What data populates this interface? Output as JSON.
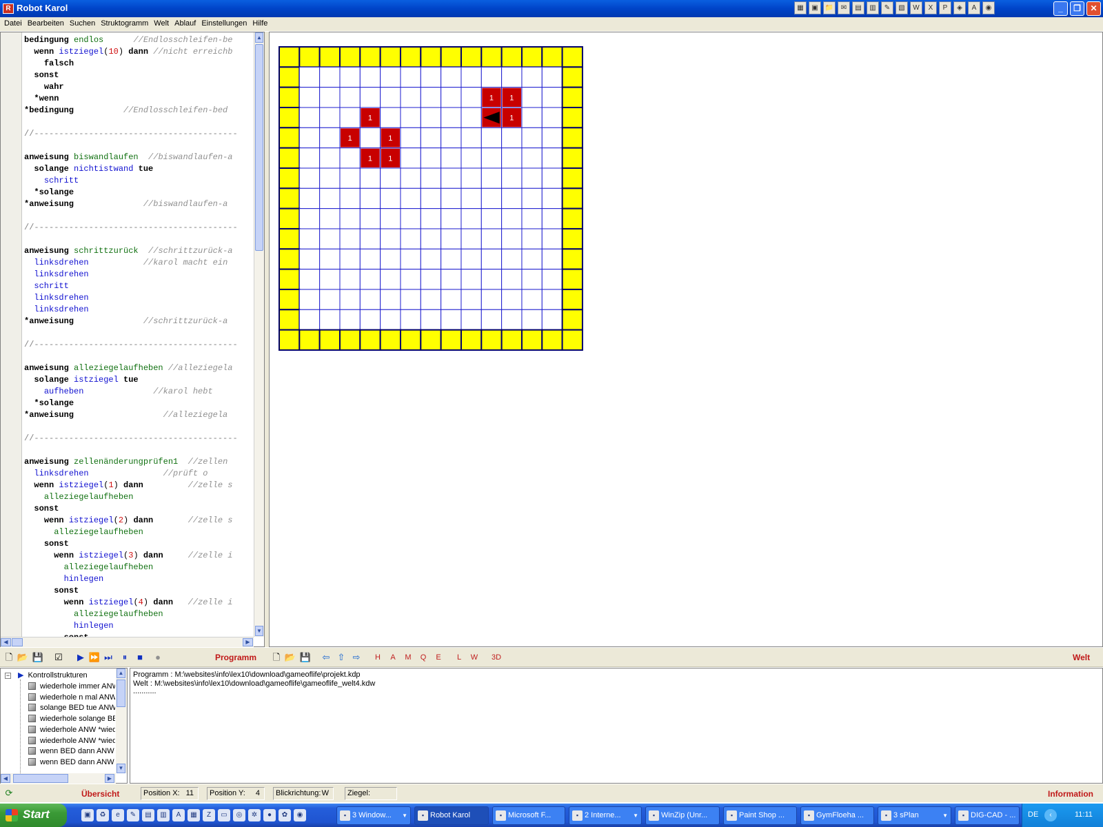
{
  "window": {
    "title": "Robot Karol",
    "icon": "robot-karol-icon",
    "tray_icons": [
      "app-icon",
      "window-icon",
      "folder-icon",
      "mail-icon",
      "doc-icon",
      "clipboard-icon",
      "note-icon",
      "book-icon",
      "word-icon",
      "excel-icon",
      "powerpoint-icon",
      "graphics-icon",
      "access-icon",
      "network-icon"
    ],
    "buttons": [
      "_",
      "❐",
      "✕"
    ]
  },
  "menu": [
    "Datei",
    "Bearbeiten",
    "Suchen",
    "Struktogramm",
    "Welt",
    "Ablauf",
    "Einstellungen",
    "Hilfe"
  ],
  "code_lines": [
    [
      [
        "kw",
        "bedingung "
      ],
      [
        "nm",
        "endlos"
      ],
      [
        "",
        "      "
      ],
      [
        "cm",
        "//Endlosschleifen-be"
      ]
    ],
    [
      [
        "",
        "  "
      ],
      [
        "kw",
        "wenn "
      ],
      [
        "id",
        "istziegel"
      ],
      [
        "",
        "("
      ],
      [
        "num",
        "10"
      ],
      [
        "",
        ") "
      ],
      [
        "kw",
        "dann"
      ],
      [
        "",
        " "
      ],
      [
        "cm",
        "//nicht erreichb"
      ]
    ],
    [
      [
        "",
        "    "
      ],
      [
        "kw",
        "falsch"
      ]
    ],
    [
      [
        "",
        "  "
      ],
      [
        "kw",
        "sonst"
      ]
    ],
    [
      [
        "",
        "    "
      ],
      [
        "kw",
        "wahr"
      ]
    ],
    [
      [
        "",
        "  "
      ],
      [
        "kw",
        "*wenn"
      ]
    ],
    [
      [
        "kw",
        "*bedingung"
      ],
      [
        "",
        "          "
      ],
      [
        "cm",
        "//Endlosschleifen-bed"
      ]
    ],
    [],
    [
      [
        "dash",
        "//-----------------------------------------"
      ]
    ],
    [],
    [
      [
        "kw",
        "anweisung "
      ],
      [
        "nm",
        "biswandlaufen"
      ],
      [
        "",
        "  "
      ],
      [
        "cm",
        "//biswandlaufen-a"
      ]
    ],
    [
      [
        "",
        "  "
      ],
      [
        "kw",
        "solange "
      ],
      [
        "id",
        "nichtistwand"
      ],
      [
        "",
        " "
      ],
      [
        "kw",
        "tue"
      ]
    ],
    [
      [
        "",
        "    "
      ],
      [
        "id",
        "schritt"
      ]
    ],
    [
      [
        "",
        "  "
      ],
      [
        "kw",
        "*solange"
      ]
    ],
    [
      [
        "kw",
        "*anweisung"
      ],
      [
        "",
        "              "
      ],
      [
        "cm",
        "//biswandlaufen-a"
      ]
    ],
    [],
    [
      [
        "dash",
        "//-----------------------------------------"
      ]
    ],
    [],
    [
      [
        "kw",
        "anweisung "
      ],
      [
        "nm",
        "schrittzurück"
      ],
      [
        "",
        "  "
      ],
      [
        "cm",
        "//schrittzurück-a"
      ]
    ],
    [
      [
        "",
        "  "
      ],
      [
        "id",
        "linksdrehen"
      ],
      [
        "",
        "           "
      ],
      [
        "cm",
        "//karol macht ein"
      ]
    ],
    [
      [
        "",
        "  "
      ],
      [
        "id",
        "linksdrehen"
      ]
    ],
    [
      [
        "",
        "  "
      ],
      [
        "id",
        "schritt"
      ]
    ],
    [
      [
        "",
        "  "
      ],
      [
        "id",
        "linksdrehen"
      ]
    ],
    [
      [
        "",
        "  "
      ],
      [
        "id",
        "linksdrehen"
      ]
    ],
    [
      [
        "kw",
        "*anweisung"
      ],
      [
        "",
        "              "
      ],
      [
        "cm",
        "//schrittzurück-a"
      ]
    ],
    [],
    [
      [
        "dash",
        "//-----------------------------------------"
      ]
    ],
    [],
    [
      [
        "kw",
        "anweisung "
      ],
      [
        "nm",
        "alleziegelaufheben"
      ],
      [
        "",
        " "
      ],
      [
        "cm",
        "//alleziegela"
      ]
    ],
    [
      [
        "",
        "  "
      ],
      [
        "kw",
        "solange "
      ],
      [
        "id",
        "istziegel"
      ],
      [
        "",
        " "
      ],
      [
        "kw",
        "tue"
      ]
    ],
    [
      [
        "",
        "    "
      ],
      [
        "id",
        "aufheben"
      ],
      [
        "",
        "              "
      ],
      [
        "cm",
        "//karol hebt"
      ]
    ],
    [
      [
        "",
        "  "
      ],
      [
        "kw",
        "*solange"
      ]
    ],
    [
      [
        "kw",
        "*anweisung"
      ],
      [
        "",
        "                  "
      ],
      [
        "cm",
        "//alleziegela"
      ]
    ],
    [],
    [
      [
        "dash",
        "//-----------------------------------------"
      ]
    ],
    [],
    [
      [
        "kw",
        "anweisung "
      ],
      [
        "nm",
        "zellenänderungprüfen1"
      ],
      [
        "",
        "  "
      ],
      [
        "cm",
        "//zellen"
      ]
    ],
    [
      [
        "",
        "  "
      ],
      [
        "id",
        "linksdrehen"
      ],
      [
        "",
        "               "
      ],
      [
        "cm",
        "//prüft o"
      ]
    ],
    [
      [
        "",
        "  "
      ],
      [
        "kw",
        "wenn "
      ],
      [
        "id",
        "istziegel"
      ],
      [
        "",
        "("
      ],
      [
        "num",
        "1"
      ],
      [
        "",
        ") "
      ],
      [
        "kw",
        "dann"
      ],
      [
        "",
        "         "
      ],
      [
        "cm",
        "//zelle s"
      ]
    ],
    [
      [
        "",
        "    "
      ],
      [
        "nm",
        "alleziegelaufheben"
      ]
    ],
    [
      [
        "",
        "  "
      ],
      [
        "kw",
        "sonst"
      ]
    ],
    [
      [
        "",
        "    "
      ],
      [
        "kw",
        "wenn "
      ],
      [
        "id",
        "istziegel"
      ],
      [
        "",
        "("
      ],
      [
        "num",
        "2"
      ],
      [
        "",
        ") "
      ],
      [
        "kw",
        "dann"
      ],
      [
        "",
        "       "
      ],
      [
        "cm",
        "//zelle s"
      ]
    ],
    [
      [
        "",
        "      "
      ],
      [
        "nm",
        "alleziegelaufheben"
      ]
    ],
    [
      [
        "",
        "    "
      ],
      [
        "kw",
        "sonst"
      ]
    ],
    [
      [
        "",
        "      "
      ],
      [
        "kw",
        "wenn "
      ],
      [
        "id",
        "istziegel"
      ],
      [
        "",
        "("
      ],
      [
        "num",
        "3"
      ],
      [
        "",
        ") "
      ],
      [
        "kw",
        "dann"
      ],
      [
        "",
        "     "
      ],
      [
        "cm",
        "//zelle i"
      ]
    ],
    [
      [
        "",
        "        "
      ],
      [
        "nm",
        "alleziegelaufheben"
      ]
    ],
    [
      [
        "",
        "        "
      ],
      [
        "id",
        "hinlegen"
      ]
    ],
    [
      [
        "",
        "      "
      ],
      [
        "kw",
        "sonst"
      ]
    ],
    [
      [
        "",
        "        "
      ],
      [
        "kw",
        "wenn "
      ],
      [
        "id",
        "istziegel"
      ],
      [
        "",
        "("
      ],
      [
        "num",
        "4"
      ],
      [
        "",
        ") "
      ],
      [
        "kw",
        "dann"
      ],
      [
        "",
        "   "
      ],
      [
        "cm",
        "//zelle i"
      ]
    ],
    [
      [
        "",
        "          "
      ],
      [
        "nm",
        "alleziegelaufheben"
      ]
    ],
    [
      [
        "",
        "          "
      ],
      [
        "id",
        "hinlegen"
      ]
    ],
    [
      [
        "",
        "        "
      ],
      [
        "kw",
        "sonst"
      ]
    ]
  ],
  "world": {
    "cols": 15,
    "rows": 15,
    "wall_color": "#ffff00",
    "grid_color": "#2020d0",
    "brick_color": "#c80000",
    "bricks": [
      {
        "col": 10,
        "row": 2,
        "count": "1"
      },
      {
        "col": 11,
        "row": 2,
        "count": "1"
      },
      {
        "col": 11,
        "row": 3,
        "count": "1"
      },
      {
        "col": 4,
        "row": 3,
        "count": "1"
      },
      {
        "col": 3,
        "row": 4,
        "count": "1"
      },
      {
        "col": 5,
        "row": 4,
        "count": "1"
      },
      {
        "col": 4,
        "row": 5,
        "count": "1"
      },
      {
        "col": 5,
        "row": 5,
        "count": "1"
      }
    ],
    "robot": {
      "col": 10,
      "row": 3,
      "direction": "W",
      "brick_color": "#c80000"
    }
  },
  "toolbar": {
    "program_label": "Programm",
    "world_label": "Welt",
    "world_buttons": [
      "H",
      "A",
      "M",
      "Q",
      "E",
      "L",
      "W",
      "3D"
    ]
  },
  "tree": {
    "root": "Kontrollstrukturen",
    "items": [
      "wiederhole immer ANW",
      "wiederhole n mal ANW",
      "solange BED tue ANW",
      "wiederhole solange BED",
      "wiederhole ANW *wied",
      "wiederhole ANW *wied",
      "wenn BED dann ANW",
      "wenn BED dann ANW"
    ]
  },
  "info": {
    "lines": [
      "Programm : M:\\websites\\info\\lex10\\download\\gameoflife\\projekt.kdp",
      "Welt : M:\\websites\\info\\lex10\\download\\gameoflife\\gameoflife_welt4.kdw",
      "..........."
    ]
  },
  "status": {
    "overview_label": "Übersicht",
    "pos_x_label": "Position X:",
    "pos_x": "11",
    "pos_y_label": "Position Y:",
    "pos_y": "4",
    "direction_label": "Blickrichtung:",
    "direction": "W",
    "bricks_label": "Ziegel:",
    "bricks": "",
    "info_label": "Information"
  },
  "taskbar": {
    "start": "Start",
    "tasks": [
      {
        "label": "3 Window...",
        "icon": "folder-icon",
        "drop": true
      },
      {
        "label": "Robot Karol",
        "icon": "robot-karol-icon",
        "active": true
      },
      {
        "label": "Microsoft F...",
        "icon": "frontpage-icon"
      },
      {
        "label": "2 Interne...",
        "icon": "ie-icon",
        "drop": true
      },
      {
        "label": "WinZip (Unr...",
        "icon": "winzip-icon"
      },
      {
        "label": "Paint Shop ...",
        "icon": "paintshop-icon"
      },
      {
        "label": "GymFloeha ...",
        "icon": "filezilla-icon"
      },
      {
        "label": "3 sPlan",
        "icon": "splan-icon",
        "drop": true
      },
      {
        "label": "DIG-CAD - ...",
        "icon": "digcad-icon"
      }
    ],
    "language": "DE",
    "clock": "11:11"
  }
}
